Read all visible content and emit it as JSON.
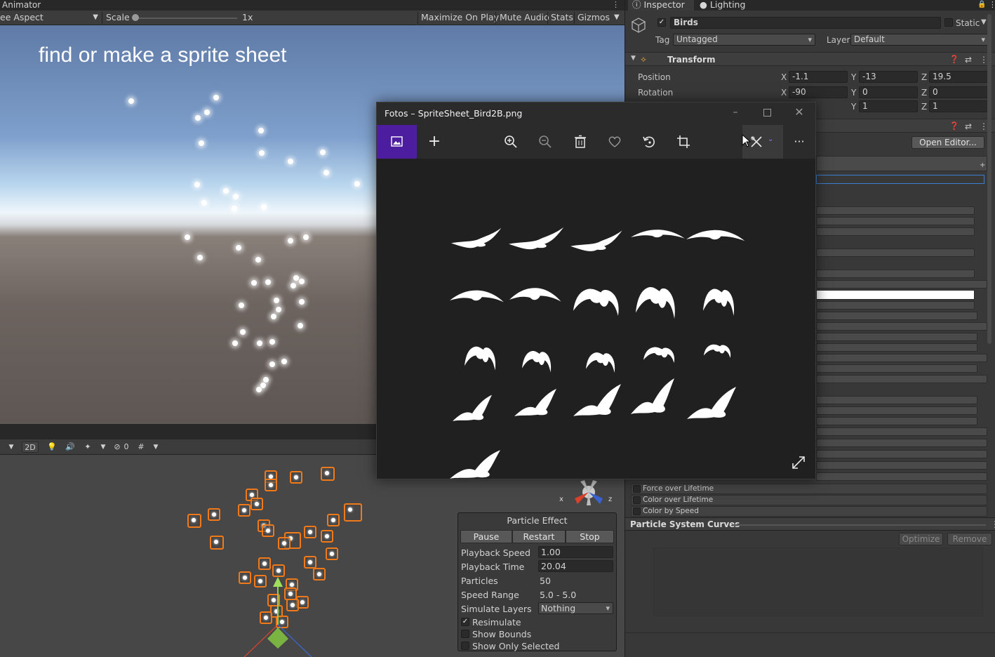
{
  "animator": {
    "title": "Animator"
  },
  "game_toolbar": {
    "aspect": "ee Aspect",
    "scale_label": "Scale",
    "scale_value": "1x",
    "maximize": "Maximize On Play",
    "mute": "Mute Audio",
    "stats": "Stats",
    "gizmos": "Gizmos"
  },
  "game_view": {
    "caption": "find or make a sprite sheet"
  },
  "scene_toolbar": {
    "mode_2d": "2D",
    "hidden_count": "0"
  },
  "gizmo_axes": {
    "x": "x",
    "z": "z"
  },
  "particle_effect": {
    "title": "Particle Effect",
    "pause": "Pause",
    "restart": "Restart",
    "stop": "Stop",
    "playback_speed_label": "Playback Speed",
    "playback_speed": "1.00",
    "playback_time_label": "Playback Time",
    "playback_time": "20.04",
    "particles_label": "Particles",
    "particles": "50",
    "speed_range_label": "Speed Range",
    "speed_range": "5.0 - 5.0",
    "simulate_layers_label": "Simulate Layers",
    "simulate_layers": "Nothing",
    "resimulate": "Resimulate",
    "resimulate_checked": true,
    "show_bounds": "Show Bounds",
    "show_only_selected": "Show Only Selected"
  },
  "inspector": {
    "tab_inspector": "Inspector",
    "tab_lighting": "Lighting",
    "object_name": "Birds",
    "static_label": "Static",
    "tag_label": "Tag",
    "tag_value": "Untagged",
    "layer_label": "Layer",
    "layer_value": "Default",
    "transform": {
      "title": "Transform",
      "position_label": "Position",
      "rotation_label": "Rotation",
      "position": {
        "x": "-1.1",
        "y": "-13",
        "z": "19.5"
      },
      "rotation": {
        "x": "-90",
        "y": "0",
        "z": "0"
      },
      "scale": {
        "y": "1",
        "z": "1"
      }
    },
    "open_editor": "Open Editor...",
    "modules": [
      "Force over Lifetime",
      "Color over Lifetime",
      "Color by Speed"
    ],
    "curves_title": "Particle System Curves",
    "optimize": "Optimize",
    "remove": "Remove"
  },
  "photos": {
    "title": "Fotos – SpriteSheet_Bird2B.png"
  },
  "colors": {
    "selection": "#f07a1a",
    "photos_accent": "#4c1d9e",
    "game_text": "#ffffff"
  }
}
